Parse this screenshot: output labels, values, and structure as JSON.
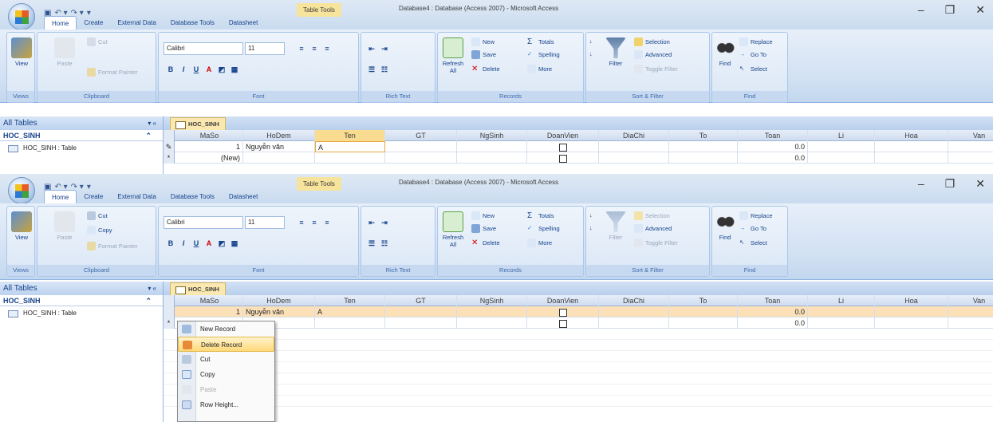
{
  "window": {
    "title": "Database4 : Database (Access 2007) - Microsoft Access",
    "tool_context": "Table Tools",
    "tabs": [
      "Home",
      "Create",
      "External Data",
      "Database Tools",
      "Datasheet"
    ],
    "controls": [
      "–",
      "❐",
      "✕"
    ]
  },
  "ribbon": {
    "views": {
      "view_label": "View",
      "group": "Views"
    },
    "clipboard": {
      "paste": "Paste",
      "cut": "Cut",
      "copy": "Copy",
      "format_painter": "Format Painter",
      "group": "Clipboard"
    },
    "font": {
      "font_name": "Calibri",
      "font_size": "11",
      "group": "Font"
    },
    "rich_text": {
      "group": "Rich Text"
    },
    "records": {
      "refresh": "Refresh All",
      "new": "New",
      "save": "Save",
      "delete": "Delete",
      "totals": "Totals",
      "spelling": "Spelling",
      "more": "More",
      "group": "Records"
    },
    "sort_filter": {
      "filter": "Filter",
      "selection": "Selection",
      "advanced": "Advanced",
      "toggle": "Toggle Filter",
      "group": "Sort & Filter"
    },
    "find": {
      "find": "Find",
      "replace": "Replace",
      "goto": "Go To",
      "select": "Select",
      "group": "Find"
    }
  },
  "nav": {
    "header": "All Tables",
    "group": "HOC_SINH",
    "item": "HOC_SINH : Table"
  },
  "table_tab": "HOC_SINH",
  "columns": [
    "MaSo",
    "HoDem",
    "Ten",
    "GT",
    "NgSinh",
    "DoanVien",
    "DiaChi",
    "To",
    "Toan",
    "Li",
    "Hoa",
    "Van"
  ],
  "top_rows": [
    {
      "sel": "✎",
      "MaSo": "1",
      "HoDem": "Nguyễn văn",
      "Ten": "A",
      "Toan": "0.0"
    },
    {
      "sel": "*",
      "MaSo": "(New)",
      "HoDem": "",
      "Ten": "",
      "Toan": "0.0"
    }
  ],
  "bottom_rows": [
    {
      "sel": "",
      "MaSo": "1",
      "HoDem": "Nguyễn văn",
      "Ten": "A",
      "Toan": "0.0"
    },
    {
      "sel": "*",
      "MaSo": "",
      "HoDem": "",
      "Ten": "",
      "Toan": "0.0"
    }
  ],
  "context_menu": [
    "New Record",
    "Delete Record",
    "Cut",
    "Copy",
    "Paste",
    "Row Height..."
  ]
}
